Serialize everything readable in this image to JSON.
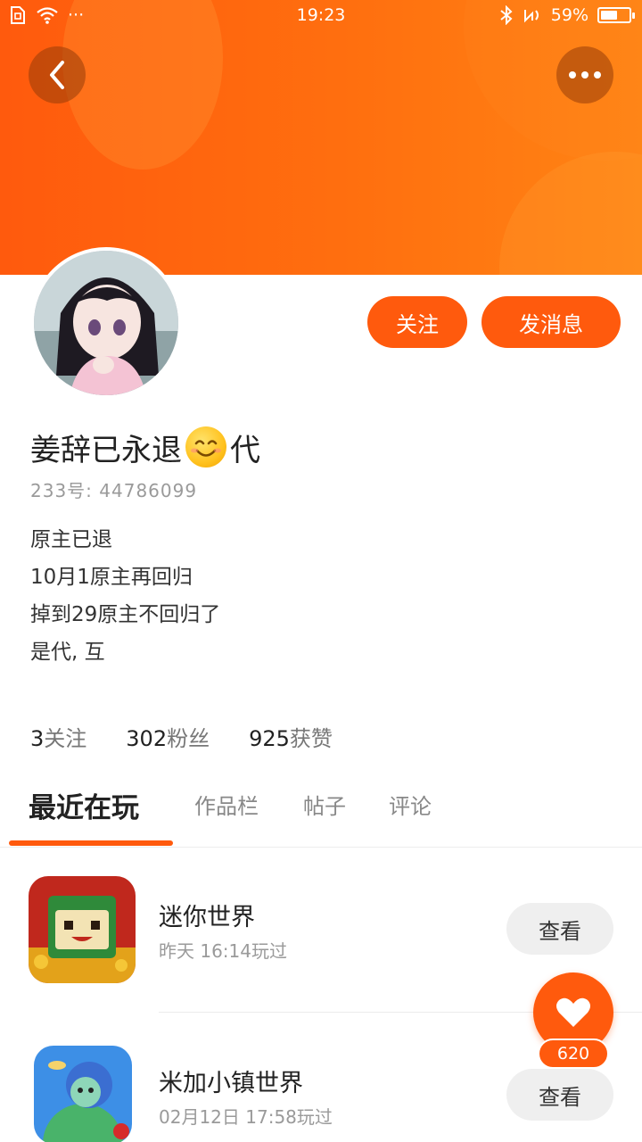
{
  "status_bar": {
    "time": "19:23",
    "battery_text": "59%",
    "battery_level": 0.59,
    "dots": "···"
  },
  "header": {
    "back_icon": "chevron-left-icon",
    "more_icon": "more-dots-icon",
    "accent_color": "#ff5a0d"
  },
  "profile": {
    "nickname": "姜辞已永退",
    "nickname_suffix": "代",
    "uid": "233号: 44786099",
    "bio": [
      "原主已退",
      "10月1原主再回归",
      "掉到29原主不回归了",
      "是代, 互"
    ],
    "follow_label": "关注",
    "message_label": "发消息"
  },
  "stats": [
    {
      "num": "3",
      "label": "关注"
    },
    {
      "num": "302",
      "label": "粉丝"
    },
    {
      "num": "925",
      "label": "获赞"
    }
  ],
  "tabs": [
    "最近在玩",
    "作品栏",
    "帖子",
    "评论"
  ],
  "games": [
    {
      "name": "迷你世界",
      "time": "昨天 16:14玩过",
      "button": "查看"
    },
    {
      "name": "米加小镇世界",
      "time": "02月12日 17:58玩过",
      "button": "查看"
    }
  ],
  "like": {
    "count": "620",
    "icon": "heart-icon"
  }
}
